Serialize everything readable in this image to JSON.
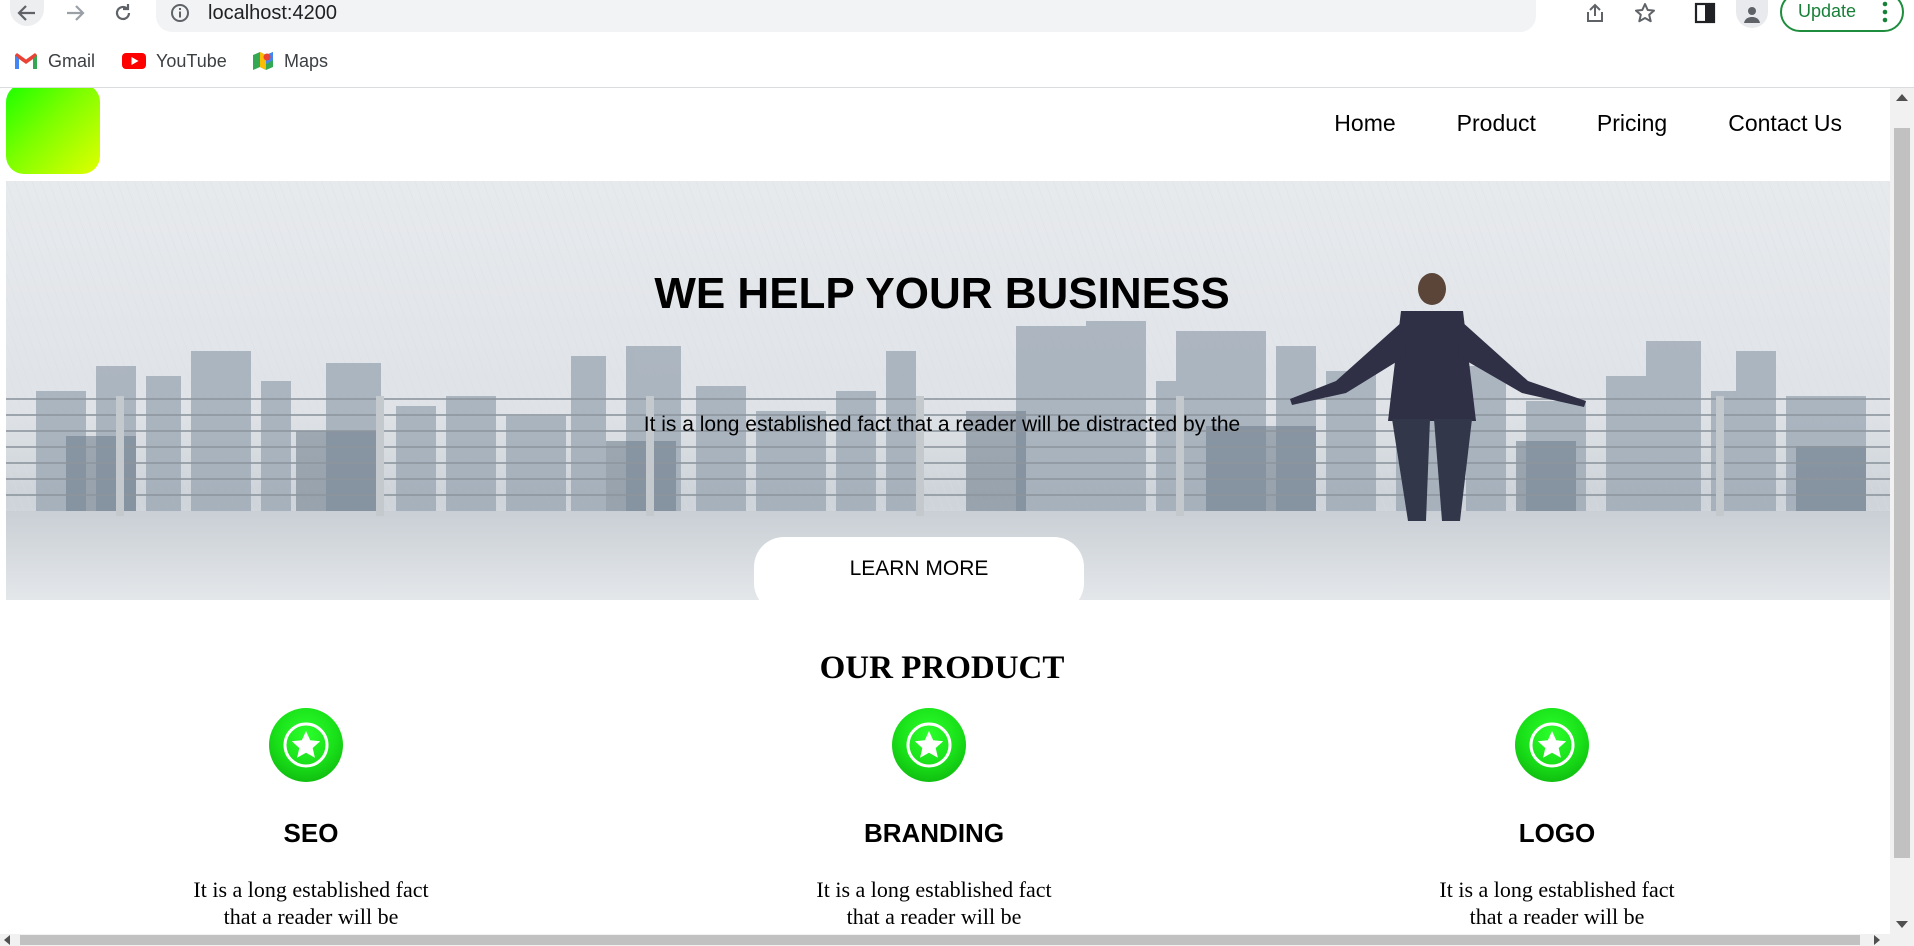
{
  "browser": {
    "url": "localhost:4200",
    "update_label": "Update",
    "bookmarks": [
      {
        "label": "Gmail",
        "icon": "gmail-icon"
      },
      {
        "label": "YouTube",
        "icon": "youtube-icon"
      },
      {
        "label": "Maps",
        "icon": "maps-icon"
      }
    ]
  },
  "site": {
    "nav": [
      "Home",
      "Product",
      "Pricing",
      "Contact Us"
    ],
    "hero": {
      "title": "WE HELP YOUR BUSINESS",
      "subtitle": "It is a long established fact that a reader will be distracted by the",
      "button": "LEARN MORE"
    },
    "products": {
      "title": "OUR PRODUCT",
      "items": [
        {
          "name": "SEO",
          "desc_line1": "It is a long established fact",
          "desc_line2": "that a reader will be",
          "icon": "star-icon"
        },
        {
          "name": "BRANDING",
          "desc_line1": "It is a long established fact",
          "desc_line2": "that a reader will be",
          "icon": "star-icon"
        },
        {
          "name": "LOGO",
          "desc_line1": "It is a long established fact",
          "desc_line2": "that a reader will be",
          "icon": "star-icon"
        }
      ]
    }
  },
  "colors": {
    "logo_gradient": [
      "#1aff00",
      "#e1ff00"
    ],
    "icon_green": "#19e019",
    "update_green": "#188038"
  }
}
